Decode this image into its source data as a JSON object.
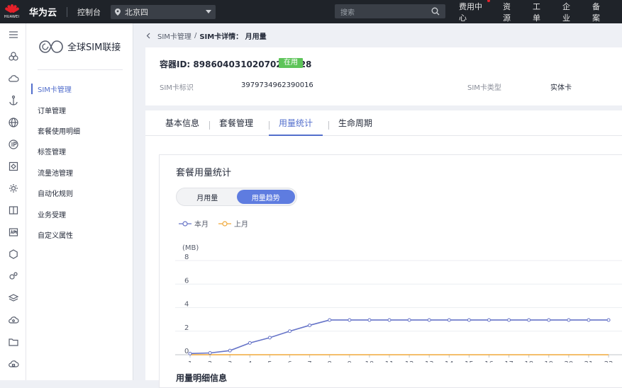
{
  "topbar": {
    "logo_text": "HUAWEI",
    "brand": "华为云",
    "console": "控制台",
    "region": "北京四",
    "search_placeholder": "搜索",
    "nav": [
      "费用中心",
      "资源",
      "工单",
      "企业",
      "备案"
    ],
    "accent": "#e6212a"
  },
  "sidebar": {
    "title": "全球SIM联接",
    "items": [
      {
        "label": "SIM卡管理",
        "active": true
      },
      {
        "label": "订单管理"
      },
      {
        "label": "套餐使用明细"
      },
      {
        "label": "标签管理"
      },
      {
        "label": "流量池管理"
      },
      {
        "label": "自动化规则"
      },
      {
        "label": "业务受理"
      },
      {
        "label": "自定义属性"
      }
    ],
    "rail_icons": [
      "menu-icon",
      "cloud-cluster-icon",
      "cloud-icon",
      "anchor-icon",
      "globe-icon",
      "ip-icon",
      "diamond-icon",
      "gear-network-icon",
      "book-icon",
      "api-icon",
      "hexagon-icon",
      "gears-icon",
      "stack-icon",
      "cloud-gear-icon",
      "folder-icon",
      "cloud-lock-icon"
    ]
  },
  "breadcrumb": {
    "parent": "SIM卡管理",
    "separator": "/",
    "current": "SIM卡详情： 月用量"
  },
  "detail": {
    "container_id_label": "容器ID: 89860403102070218828",
    "status": "在用",
    "sim_id_label": "SIM卡标识",
    "sim_id_value": "3979734962390016",
    "sim_type_label": "SIM卡类型",
    "sim_type_value": "实体卡"
  },
  "tabs": [
    {
      "label": "基本信息"
    },
    {
      "label": "套餐管理"
    },
    {
      "label": "用量统计",
      "active": true
    },
    {
      "label": "生命周期"
    }
  ],
  "usage": {
    "title": "套餐用量统计",
    "toggle": [
      {
        "label": "月用量"
      },
      {
        "label": "用量趋势",
        "active": true
      }
    ],
    "below_title": "用量明细信息"
  },
  "chart_data": {
    "type": "line",
    "ylabel": "(MB)",
    "ylim": [
      0,
      8
    ],
    "yticks": [
      0,
      2,
      4,
      6,
      8
    ],
    "x": [
      1,
      2,
      3,
      4,
      5,
      6,
      7,
      8,
      9,
      10,
      11,
      12,
      13,
      14,
      15,
      16,
      17,
      18,
      19,
      20,
      21,
      22
    ],
    "grid": true,
    "legend": "top-left",
    "series": [
      {
        "name": "本月",
        "color": "#6674c8",
        "values": [
          0.1,
          0.15,
          0.35,
          1.0,
          1.45,
          2.0,
          2.5,
          2.95,
          2.95,
          2.95,
          2.95,
          2.95,
          2.95,
          2.95,
          2.95,
          2.95,
          2.95,
          2.95,
          2.95,
          2.95,
          2.95,
          2.95
        ]
      },
      {
        "name": "上月",
        "color": "#f0a93a",
        "values": [
          0,
          0,
          0,
          0,
          0,
          0,
          0,
          0,
          0,
          0,
          0,
          0,
          0,
          0,
          0,
          0,
          0,
          0,
          0,
          0,
          0,
          0
        ]
      }
    ]
  }
}
